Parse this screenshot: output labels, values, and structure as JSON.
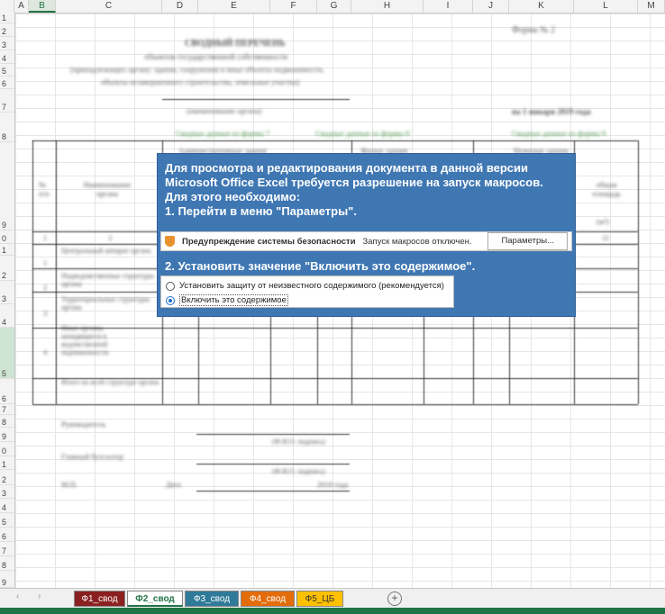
{
  "columns": [
    "A",
    "B",
    "C",
    "D",
    "E",
    "F",
    "G",
    "H",
    "I",
    "J",
    "K",
    "L",
    "M"
  ],
  "selected_column": "B",
  "rows": [
    "1",
    "2",
    "3",
    "4",
    "5",
    "6",
    "7",
    "8",
    "9",
    "0",
    "1",
    "2",
    "3",
    "4",
    "5",
    "6",
    "7",
    "8",
    "9",
    "0",
    "1",
    "2",
    "3",
    "4",
    "5",
    "6",
    "7",
    "8",
    "9"
  ],
  "document": {
    "form_no": "Форма № 2",
    "title": "СВОДНЫЙ ПЕРЕЧЕНЬ",
    "subtitle1": "объектов государственной собственности",
    "subtitle2": "(принадлежащих органу: здания, сооружения и иные объекты недвижимости,",
    "subtitle3": "объекты незавершенного строительства, земельные участки)",
    "org_caption": "(наименование органа)",
    "date": "на 1 января 2019 года",
    "green1": "Сводные данные из формы 7",
    "green2": "Сводные данные из формы 8",
    "green3": "Сводные данные из формы 9",
    "sub1": "Административные здания",
    "sub2": "Жилые здания",
    "sub3": "Нежилые здания",
    "col_no": "№ п/п",
    "col_name": "Наименование органа",
    "col_area": "общая площадь",
    "col_unit": "(м²)",
    "num1": "1",
    "num2": "2",
    "num11": "11",
    "r1": "Центральный аппарат органа",
    "r2": "Подведомственные структуры органа",
    "r3": "Территориальные структуры органа",
    "r4": "Иные органы, находящиеся в ведомственной подчиненности",
    "r5": "Итого по всей структуре органа",
    "n1": "1",
    "n2": "2",
    "n3": "3",
    "n4": "4",
    "head": "Руководитель",
    "acct": "Главный бухгалтер",
    "sign": "(Ф.И.О. подпись)",
    "mp": "М.П.",
    "date_label": "Дата",
    "year": "2018 года"
  },
  "overlay": {
    "line1": "Для просмотра и редактирования документа в данной версии",
    "line2": "Microsoft Office Excel требуется разрешение на запуск макросов.",
    "line3": "Для этого необходимо:",
    "line4": "1. Перейти в меню \"Параметры\".",
    "security_title": "Предупреждение системы безопасности",
    "security_msg": "Запуск макросов отключен.",
    "security_btn": "Параметры...",
    "step2": "2. Установить значение \"Включить это содержимое\".",
    "option1": "Установить защиту от неизвестного содержимого (рекомендуется)",
    "option2": "Включить это содержимое",
    "selected_option": "option2"
  },
  "tabs": [
    {
      "label": "Ф1_свод",
      "color": "#8b2020",
      "text_color": "#ffffff",
      "active": false
    },
    {
      "label": "Ф2_свод",
      "color": "#ffffff",
      "text_color": "#217346",
      "active": true
    },
    {
      "label": "Ф3_свод",
      "color": "#2f7a99",
      "text_color": "#ffffff",
      "active": false
    },
    {
      "label": "Ф4_свод",
      "color": "#e36c0a",
      "text_color": "#ffffff",
      "active": false
    },
    {
      "label": "Ф5_ЦБ",
      "color": "#ffc000",
      "text_color": "#333333",
      "active": false
    }
  ],
  "add_sheet_symbol": "+",
  "nav_prev": "‹",
  "nav_next": "›",
  "colors": {
    "excel_green": "#217346",
    "overlay_blue": "#3f77b3"
  }
}
